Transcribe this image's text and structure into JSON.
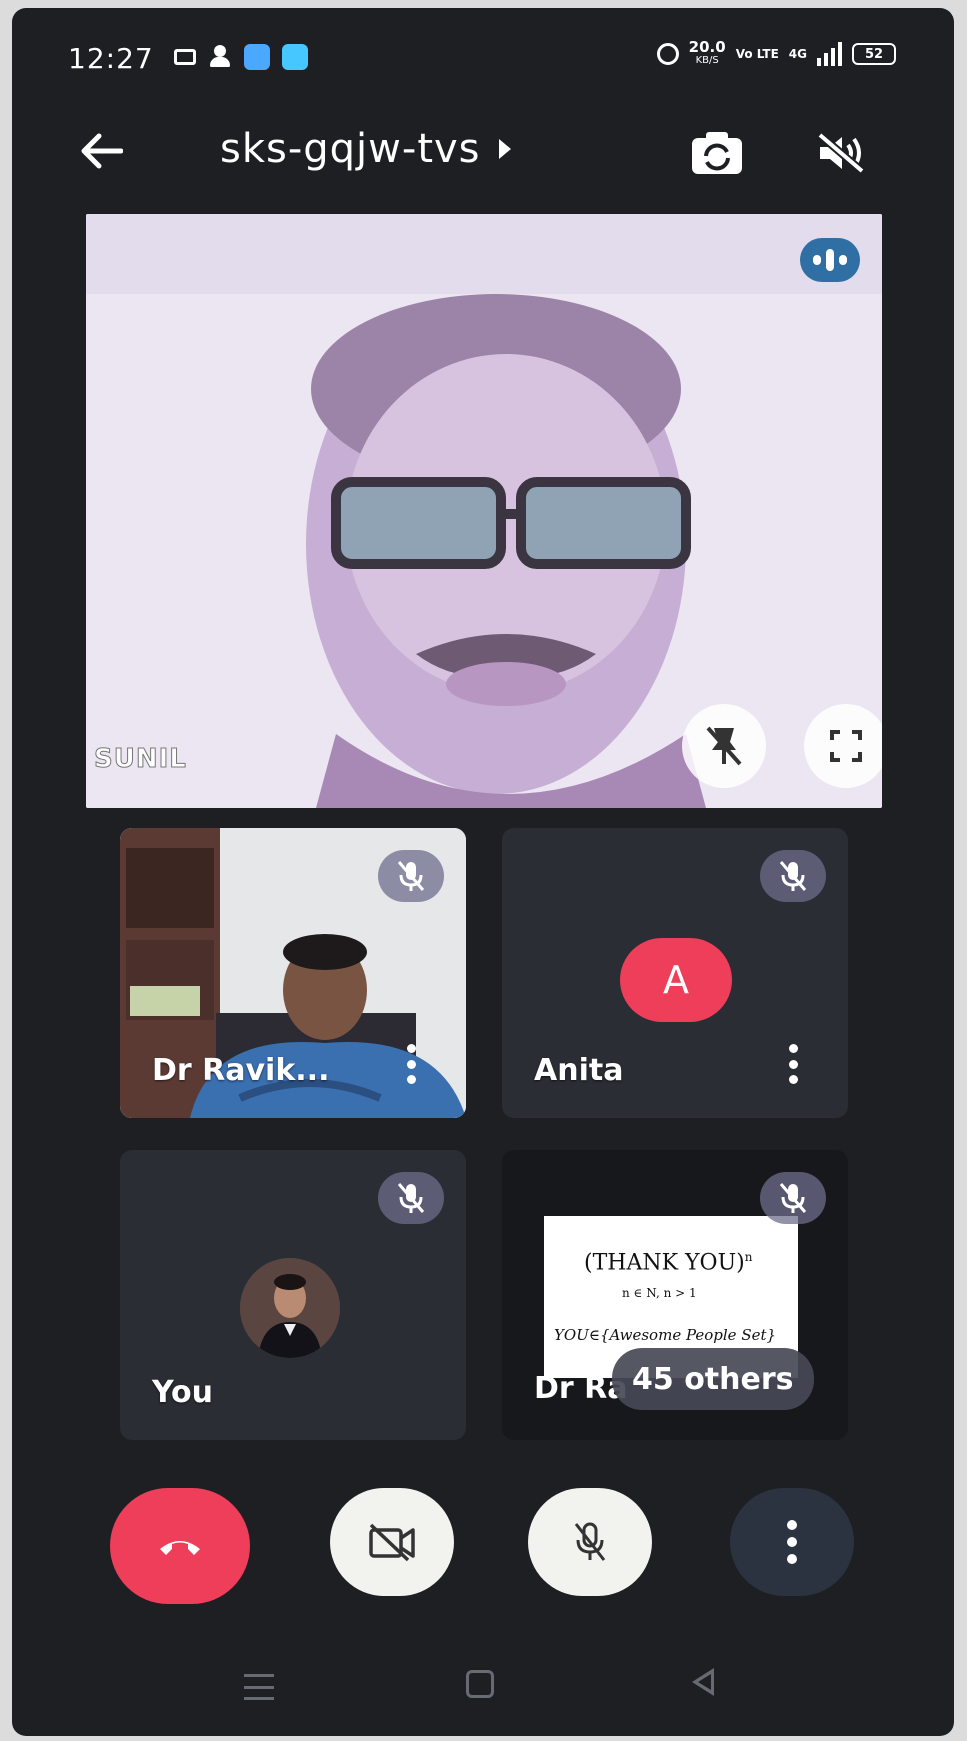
{
  "status_bar": {
    "time": "12:27",
    "net_speed": "20.0",
    "net_unit": "KB/S",
    "lte": "Vo LTE",
    "network": "4G",
    "battery": "52"
  },
  "top_bar": {
    "meeting_code": "sks-gqjw-tvs"
  },
  "main_video": {
    "participant_label": "SUNIL"
  },
  "tiles": [
    {
      "name": "Dr Ravik..."
    },
    {
      "name": "Anita",
      "avatar_letter": "A"
    },
    {
      "name": "You"
    },
    {
      "name": "Dr Ra",
      "others": "45 others"
    }
  ],
  "shared_slide": {
    "line1": "(THANK YOU)",
    "line1_sup": "n",
    "line2": "n ∈ N, n > 1",
    "line3": "YOU∈{Awesome People Set}"
  },
  "colors": {
    "end_call": "#ee3e5a",
    "avatar": "#ee3e5a",
    "speaker_indicator": "#2f6fa3",
    "background": "#1d1f23"
  },
  "icons": [
    "back-arrow-icon",
    "camera-flip-icon",
    "speaker-off-icon",
    "pin-off-icon",
    "fullscreen-icon",
    "mic-off-icon",
    "more-vert-icon",
    "end-call-icon",
    "camera-off-icon"
  ]
}
